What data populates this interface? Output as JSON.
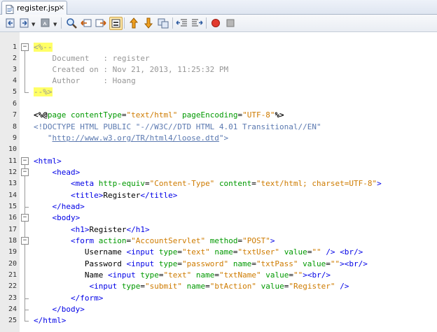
{
  "tab": {
    "label": "register.jsp",
    "close": "×"
  },
  "toolbar": {
    "buttons": [
      "back-icon",
      "forward-menu-icon",
      "last-edit-icon",
      "find-icon",
      "find-previous-icon",
      "find-next-icon",
      "toggle-highlight-icon",
      "previous-bookmark-icon",
      "next-bookmark-icon",
      "toggle-bookmark-icon",
      "shift-left-icon",
      "shift-right-icon",
      "record-macro-icon",
      "stop-macro-icon"
    ]
  },
  "colors": {
    "tag": "#0000e6",
    "attribute": "#009900",
    "value": "#ce7b00",
    "comment": "#969696",
    "highlight": "#ffff66"
  },
  "editor": {
    "line_numbers": [
      "1",
      "2",
      "3",
      "4",
      "5",
      "6",
      "7",
      "8",
      "9",
      "10",
      "11",
      "12",
      "13",
      "14",
      "15",
      "16",
      "17",
      "18",
      "19",
      "20",
      "21",
      "22",
      "23",
      "24",
      "25"
    ],
    "lines": [
      "<%--",
      "    Document   : register",
      "    Created on : Nov 21, 2013, 11:25:32 PM",
      "    Author     : Hoang",
      "--%>",
      "",
      "<%@page contentType=\"text/html\" pageEncoding=\"UTF-8\"%>",
      "<!DOCTYPE HTML PUBLIC \"-//W3C//DTD HTML 4.01 Transitional//EN\"",
      "   \"http://www.w3.org/TR/html4/loose.dtd\">",
      "",
      "<html>",
      "    <head>",
      "        <meta http-equiv=\"Content-Type\" content=\"text/html; charset=UTF-8\">",
      "        <title>Register</title>",
      "    </head>",
      "    <body>",
      "        <h1>Register</h1>",
      "        <form action=\"AccountServlet\" method=\"POST\">",
      "           Username <input type=\"text\" name=\"txtUser\" value=\"\" /> <br/>",
      "           Password <input type=\"password\" name=\"txtPass\" value=\"\"><br/>",
      "           Name <input type=\"text\" name=\"txtName\" value=\"\"><br/>",
      "            <input type=\"submit\" name=\"btAction\" value=\"Register\" />",
      "        </form>",
      "    </body>",
      "</html>"
    ]
  }
}
